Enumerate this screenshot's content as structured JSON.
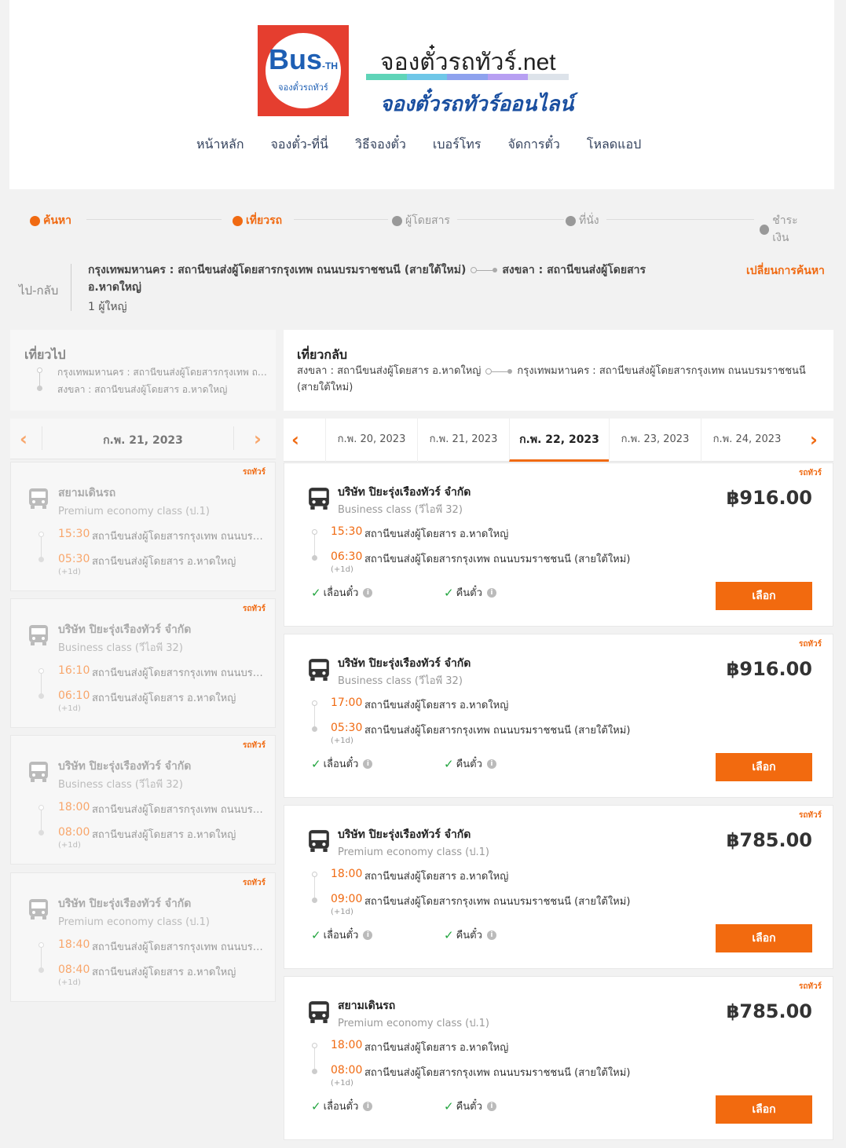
{
  "brand": {
    "logo_text": "Bus",
    "logo_suffix": "-TH",
    "logo_sub": "จองตั๋วรถทัวร์",
    "site_name": "จองตั๋วรถทัวร์.net",
    "tagline": "จองตั๋วรถทัวร์ออนไลน์",
    "bar_colors": [
      "#5fd4b8",
      "#6fc7e8",
      "#8ea2ee",
      "#b79ff2",
      "#dde3ea"
    ]
  },
  "nav": [
    "หน้าหลัก",
    "จองตั๋ว-ที่นี่",
    "วิธีจองตั๋ว",
    "เบอร์โทร",
    "จัดการตั๋ว",
    "โหลดแอป"
  ],
  "steps": [
    {
      "label": "ค้นหา",
      "active": true
    },
    {
      "label": "เที่ยวรถ",
      "active": true
    },
    {
      "label": "ผู้โดยสาร",
      "active": false
    },
    {
      "label": "ที่นั่ง",
      "active": false
    },
    {
      "label": "ชำระเงิน",
      "active": false
    }
  ],
  "summary": {
    "trip_type": "ไป-กลับ",
    "origin": "กรุงเทพมหานคร : สถานีขนส่งผู้โดยสารกรุงเทพ ถนนบรมราชชนนี (สายใต้ใหม่)",
    "destination": "สงขลา : สถานีขนส่งผู้โดยสาร อ.หาดใหญ่",
    "passengers": "1 ผู้ใหญ่",
    "change_search": "เปลี่ยนการค้นหา"
  },
  "outbound": {
    "title": "เที่ยวไป",
    "from": "กรุงเทพมหานคร : สถานีขนส่งผู้โดยสารกรุงเทพ ถนนบรมราชชนนี (สายใต้ใหม่)",
    "to": "สงขลา : สถานีขนส่งผู้โดยสาร อ.หาดใหญ่",
    "date": "ก.พ. 21, 2023",
    "trips": [
      {
        "tag": "รถทัวร์",
        "operator": "สยามเดินรถ",
        "class": "Premium economy class (ป.1)",
        "dep_time": "15:30",
        "dep_station": "สถานีขนส่งผู้โดยสารกรุงเทพ ถนนบรมราชชนนี (สายใต้ใหม่)",
        "arr_time": "05:30",
        "arr_station": "สถานีขนส่งผู้โดยสาร อ.หาดใหญ่",
        "plus_day": "(+1d)"
      },
      {
        "tag": "รถทัวร์",
        "operator": "บริษัท ปิยะรุ่งเรืองทัวร์ จำกัด",
        "class": "Business class (วีไอพี 32)",
        "dep_time": "16:10",
        "dep_station": "สถานีขนส่งผู้โดยสารกรุงเทพ ถนนบรมราชชนนี (สายใต้ใหม่)",
        "arr_time": "06:10",
        "arr_station": "สถานีขนส่งผู้โดยสาร อ.หาดใหญ่",
        "plus_day": "(+1d)"
      },
      {
        "tag": "รถทัวร์",
        "operator": "บริษัท ปิยะรุ่งเรืองทัวร์ จำกัด",
        "class": "Business class (วีไอพี 32)",
        "dep_time": "18:00",
        "dep_station": "สถานีขนส่งผู้โดยสารกรุงเทพ ถนนบรมราชชนนี (สายใต้ใหม่)",
        "arr_time": "08:00",
        "arr_station": "สถานีขนส่งผู้โดยสาร อ.หาดใหญ่",
        "plus_day": "(+1d)"
      },
      {
        "tag": "รถทัวร์",
        "operator": "บริษัท ปิยะรุ่งเรืองทัวร์ จำกัด",
        "class": "Premium economy class (ป.1)",
        "dep_time": "18:40",
        "dep_station": "สถานีขนส่งผู้โดยสารกรุงเทพ ถนนบรมราชชนนี (สายใต้ใหม่)",
        "arr_time": "08:40",
        "arr_station": "สถานีขนส่งผู้โดยสาร อ.หาดใหญ่",
        "plus_day": "(+1d)"
      }
    ]
  },
  "return": {
    "title": "เที่ยวกลับ",
    "from": "สงขลา : สถานีขนส่งผู้โดยสาร อ.หาดใหญ่",
    "to": "กรุงเทพมหานคร : สถานีขนส่งผู้โดยสารกรุงเทพ ถนนบรมราชชนนี (สายใต้ใหม่)",
    "dates": [
      "ก.พ. 20, 2023",
      "ก.พ. 21, 2023",
      "ก.พ. 22, 2023",
      "ก.พ. 23, 2023",
      "ก.พ. 24, 2023"
    ],
    "selected_date": "ก.พ. 22, 2023",
    "trips": [
      {
        "tag": "รถทัวร์",
        "operator": "บริษัท ปิยะรุ่งเรืองทัวร์ จำกัด",
        "class": "Business class (วีไอพี 32)",
        "price": "฿916.00",
        "dep_time": "15:30",
        "dep_station": "สถานีขนส่งผู้โดยสาร อ.หาดใหญ่",
        "arr_time": "06:30",
        "arr_station": "สถานีขนส่งผู้โดยสารกรุงเทพ ถนนบรมราชชนนี (สายใต้ใหม่)",
        "plus_day": "(+1d)",
        "reschedule": "เลื่อนตั๋ว",
        "refund": "คืนตั๋ว",
        "select": "เลือก"
      },
      {
        "tag": "รถทัวร์",
        "operator": "บริษัท ปิยะรุ่งเรืองทัวร์ จำกัด",
        "class": "Business class (วีไอพี 32)",
        "price": "฿916.00",
        "dep_time": "17:00",
        "dep_station": "สถานีขนส่งผู้โดยสาร อ.หาดใหญ่",
        "arr_time": "05:30",
        "arr_station": "สถานีขนส่งผู้โดยสารกรุงเทพ ถนนบรมราชชนนี (สายใต้ใหม่)",
        "plus_day": "(+1d)",
        "reschedule": "เลื่อนตั๋ว",
        "refund": "คืนตั๋ว",
        "select": "เลือก"
      },
      {
        "tag": "รถทัวร์",
        "operator": "บริษัท ปิยะรุ่งเรืองทัวร์ จำกัด",
        "class": "Premium economy class (ป.1)",
        "price": "฿785.00",
        "dep_time": "18:00",
        "dep_station": "สถานีขนส่งผู้โดยสาร อ.หาดใหญ่",
        "arr_time": "09:00",
        "arr_station": "สถานีขนส่งผู้โดยสารกรุงเทพ ถนนบรมราชชนนี (สายใต้ใหม่)",
        "plus_day": "(+1d)",
        "reschedule": "เลื่อนตั๋ว",
        "refund": "คืนตั๋ว",
        "select": "เลือก"
      },
      {
        "tag": "รถทัวร์",
        "operator": "สยามเดินรถ",
        "class": "Premium economy class (ป.1)",
        "price": "฿785.00",
        "dep_time": "18:00",
        "dep_station": "สถานีขนส่งผู้โดยสาร อ.หาดใหญ่",
        "arr_time": "08:00",
        "arr_station": "สถานีขนส่งผู้โดยสารกรุงเทพ ถนนบรมราชชนนี (สายใต้ใหม่)",
        "plus_day": "(+1d)",
        "reschedule": "เลื่อนตั๋ว",
        "refund": "คืนตั๋ว",
        "select": "เลือก"
      }
    ]
  },
  "icons": {
    "bus": "bus-icon",
    "prev": "chevron-left-icon",
    "next": "chevron-right-icon",
    "check": "check-icon",
    "info": "info-icon"
  },
  "colors": {
    "accent": "#f06a12",
    "select_button": "#f26a0f",
    "check": "#22a53f"
  }
}
